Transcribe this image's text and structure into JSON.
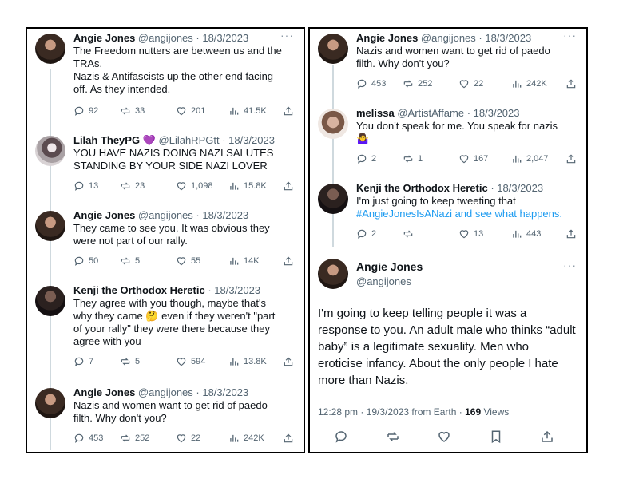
{
  "left_tweets": [
    {
      "name": "Angie Jones",
      "handle": "@angijones",
      "date": "· 18/3/2023",
      "text_lines": [
        "The Freedom nutters are between us and the",
        "TRAs.",
        "Nazis & Antifascists up the other end facing",
        "off. As they intended."
      ],
      "replies": "92",
      "retweets": "33",
      "likes": "201",
      "views": "41.5K"
    },
    {
      "name": "Lilah TheyPG",
      "name_suffix": "💜",
      "handle": "@LilahRPGtt",
      "date": "· 18/3/2023",
      "text_lines": [
        "YOU HAVE NAZIS DOING NAZI SALUTES",
        "STANDING BY YOUR SIDE NAZI LOVER"
      ],
      "replies": "13",
      "retweets": "23",
      "likes": "1,098",
      "views": "15.8K"
    },
    {
      "name": "Angie Jones",
      "handle": "@angijones",
      "date": "· 18/3/2023",
      "text_lines": [
        "They came to see you. It was obvious they",
        "were not part of our rally."
      ],
      "replies": "50",
      "retweets": "5",
      "likes": "55",
      "views": "14K"
    },
    {
      "name": "Kenji the Orthodox Heretic",
      "handle": "",
      "date": "· 18/3/2023",
      "text_lines": [
        "They agree with you though, maybe that's",
        "why they came 🤔 even if they weren't \"part",
        "of your rally\" they were there because they",
        "agree with you"
      ],
      "replies": "7",
      "retweets": "5",
      "likes": "594",
      "views": "13.8K"
    },
    {
      "name": "Angie Jones",
      "handle": "@angijones",
      "date": "· 18/3/2023",
      "text_lines": [
        "Nazis and women want to get rid of paedo",
        "filth. Why don't you?"
      ],
      "replies": "453",
      "retweets": "252",
      "likes": "22",
      "views": "242K"
    }
  ],
  "right_tweets": [
    {
      "name": "Angie Jones",
      "handle": "@angijones",
      "date": "· 18/3/2023",
      "text_lines": [
        "Nazis and women want to get rid of paedo",
        "filth. Why don't you?"
      ],
      "replies": "453",
      "retweets": "252",
      "likes": "22",
      "views": "242K"
    },
    {
      "name": "melissa",
      "handle": "@ArtistAffame",
      "date": "· 18/3/2023",
      "text_lines": [
        "You don't speak for me. You speak for nazis",
        "🤷‍♀️"
      ],
      "replies": "2",
      "retweets": "1",
      "likes": "167",
      "views": "2,047"
    },
    {
      "name": "Kenji the Orthodox Heretic",
      "handle": "",
      "date": "· 18/3/2023",
      "text_lines": [
        "I'm just going to keep tweeting that",
        "#AngieJonesIsANazi and see what happens."
      ],
      "replies": "2",
      "retweets": "",
      "likes": "13",
      "views": "443"
    }
  ],
  "main_tweet": {
    "name": "Angie Jones",
    "handle": "@angijones",
    "text": "I'm going to keep telling people it was a response to you. An adult male who thinks “adult baby” is a legitimate sexuality. Men who eroticise infancy. About the only people I hate more than Nazis.",
    "timestamp": "12:28 pm · 19/3/2023 from Earth · ",
    "views_count": "169",
    "views_label": " Views"
  },
  "more_label": "···",
  "colors": {
    "hashtag": "#1d9bf0",
    "secondary_text": "#536471",
    "divider": "#cfd9de",
    "frame_border": "#000000"
  },
  "icons": [
    "reply-icon",
    "retweet-icon",
    "like-icon",
    "views-icon",
    "share-icon",
    "bookmark-icon"
  ]
}
